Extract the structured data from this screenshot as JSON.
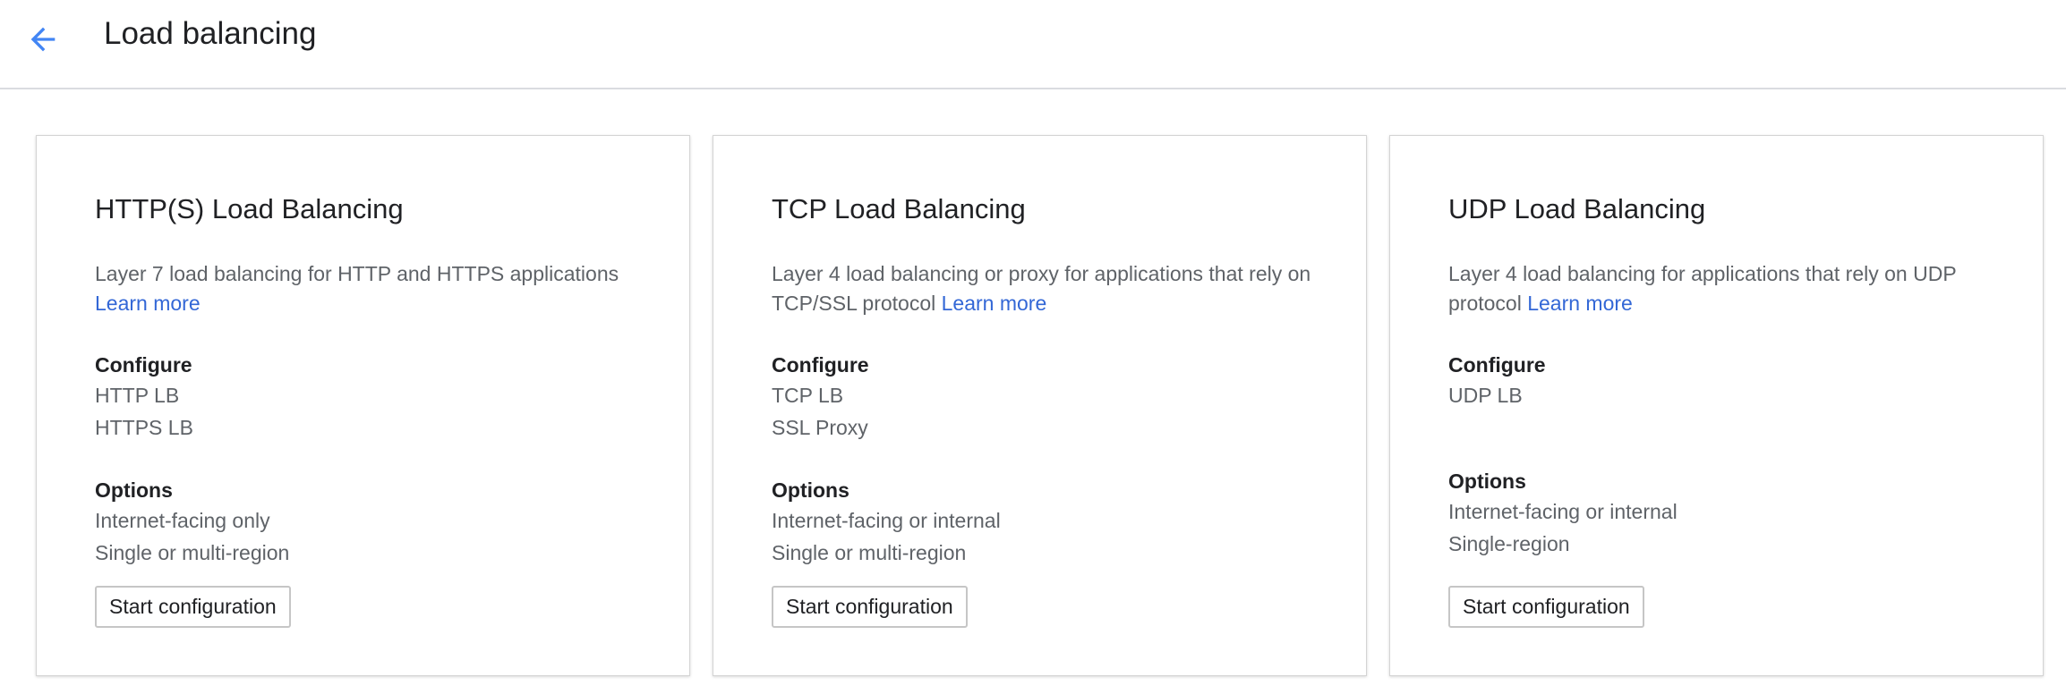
{
  "header": {
    "back_icon": "arrow-back-icon",
    "title": "Load balancing",
    "accent_color": "#4285f4"
  },
  "link_color": "#3367d6",
  "cards": [
    {
      "title": "HTTP(S) Load Balancing",
      "description": "Layer 7 load balancing for HTTP and HTTPS applications",
      "learn_more": "Learn more",
      "configure_heading": "Configure",
      "configure_items": [
        "HTTP LB",
        "HTTPS LB"
      ],
      "options_heading": "Options",
      "options_items": [
        "Internet-facing only",
        "Single or multi-region"
      ],
      "button_label": "Start configuration"
    },
    {
      "title": "TCP Load Balancing",
      "description": "Layer 4 load balancing or proxy for applications that rely on TCP/SSL protocol",
      "learn_more": "Learn more",
      "configure_heading": "Configure",
      "configure_items": [
        "TCP LB",
        "SSL Proxy"
      ],
      "options_heading": "Options",
      "options_items": [
        "Internet-facing or internal",
        "Single or multi-region"
      ],
      "button_label": "Start configuration"
    },
    {
      "title": "UDP Load Balancing",
      "description": "Layer 4 load balancing for applications that rely on UDP protocol",
      "learn_more": "Learn more",
      "configure_heading": "Configure",
      "configure_items": [
        "UDP LB"
      ],
      "options_heading": "Options",
      "options_items": [
        "Internet-facing or internal",
        "Single-region"
      ],
      "button_label": "Start configuration"
    }
  ]
}
